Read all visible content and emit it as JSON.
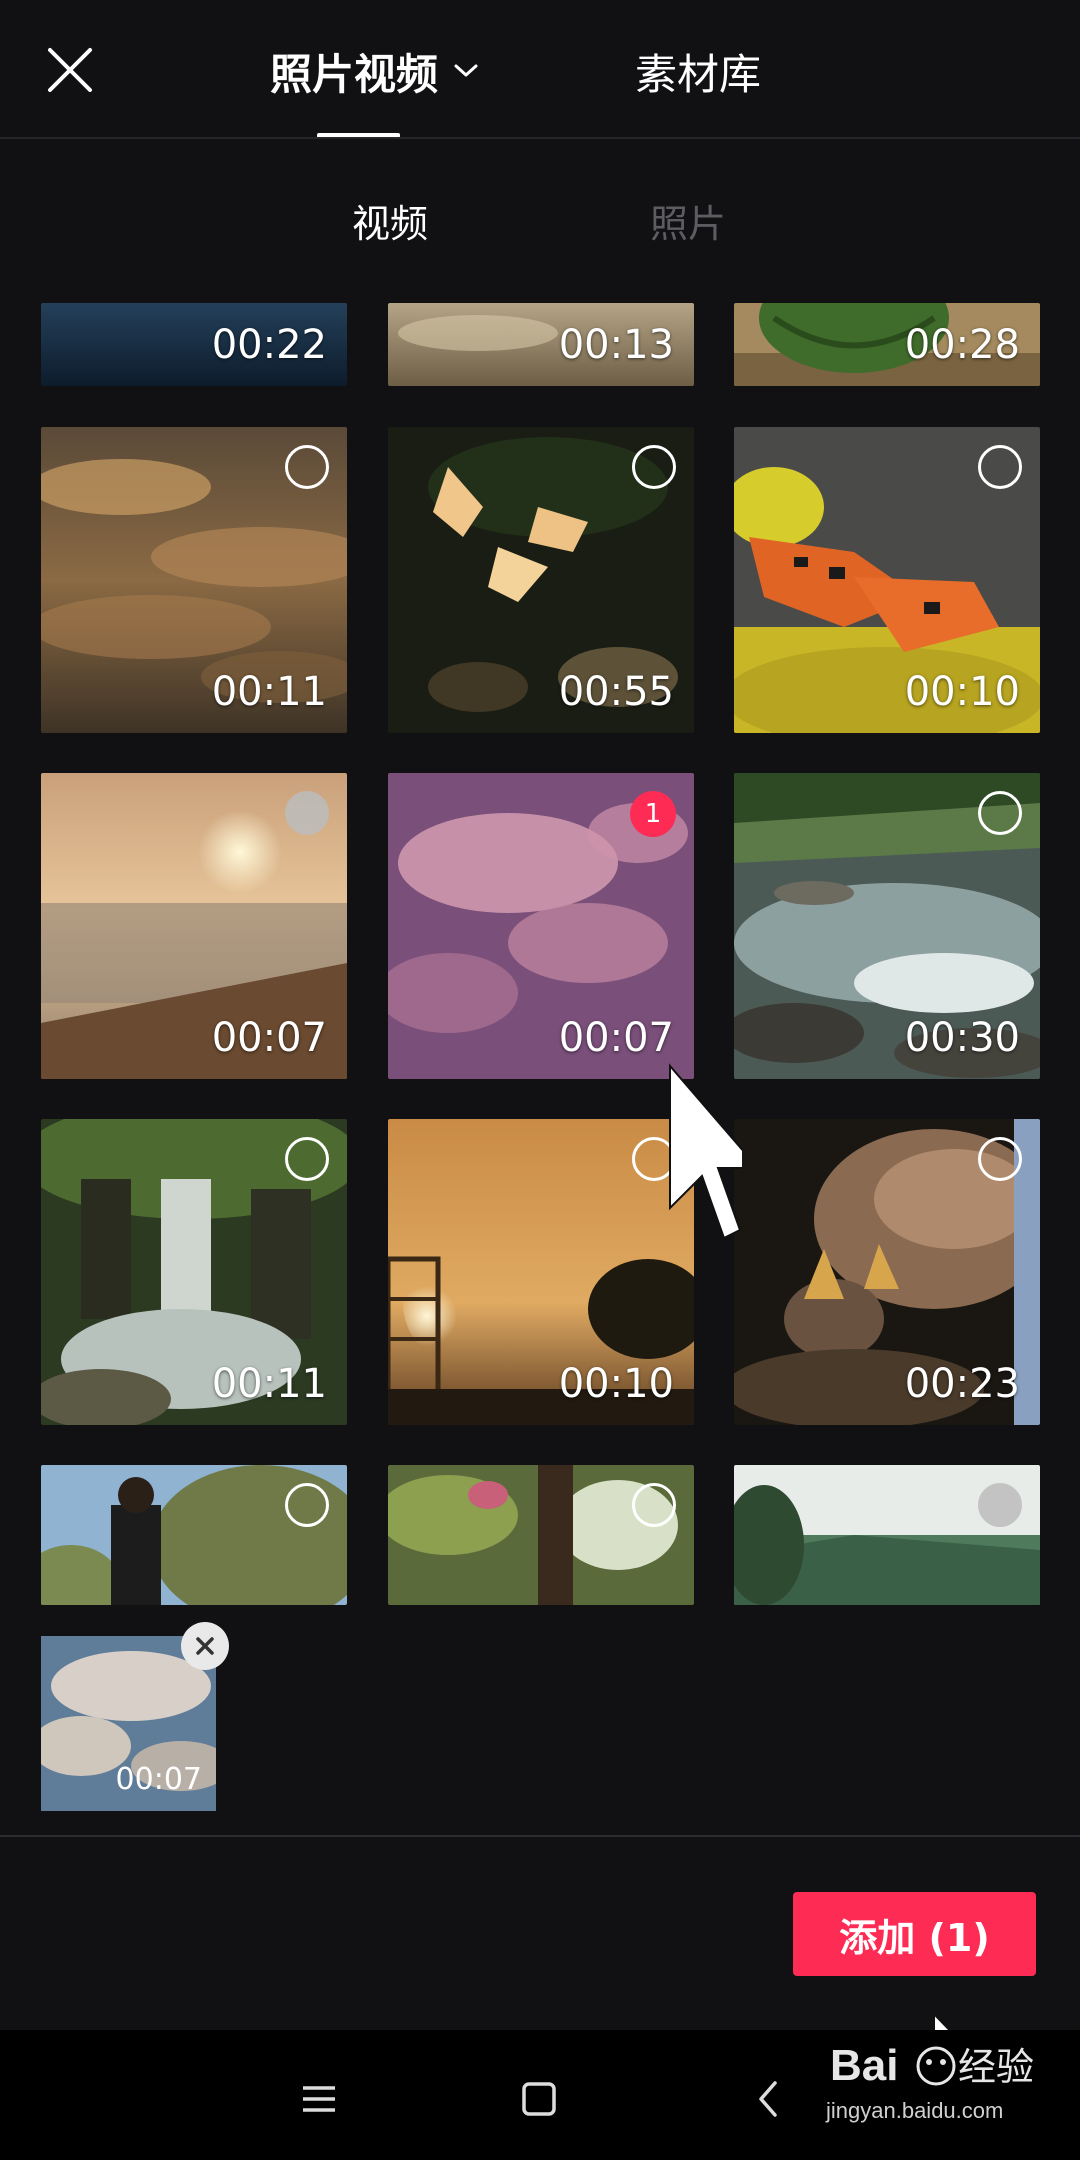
{
  "header": {
    "tab_main": "照片视频",
    "tab_library": "素材库"
  },
  "subtabs": {
    "video": "视频",
    "photo": "照片"
  },
  "grid": {
    "row0": [
      "00:22",
      "00:13",
      "00:28"
    ],
    "row1": [
      "00:11",
      "00:55",
      "00:10"
    ],
    "row2": [
      "00:07",
      "00:07",
      "00:30"
    ],
    "row3": [
      "00:11",
      "00:10",
      "00:23"
    ],
    "selected_badge": "1"
  },
  "tray": {
    "duration": "00:07"
  },
  "add_button": "添加 (1)",
  "watermark": {
    "brand": "Bai 经验",
    "url": "jingyan.baidu.com"
  },
  "colors": {
    "accent": "#fe2c55",
    "background": "#111013"
  }
}
